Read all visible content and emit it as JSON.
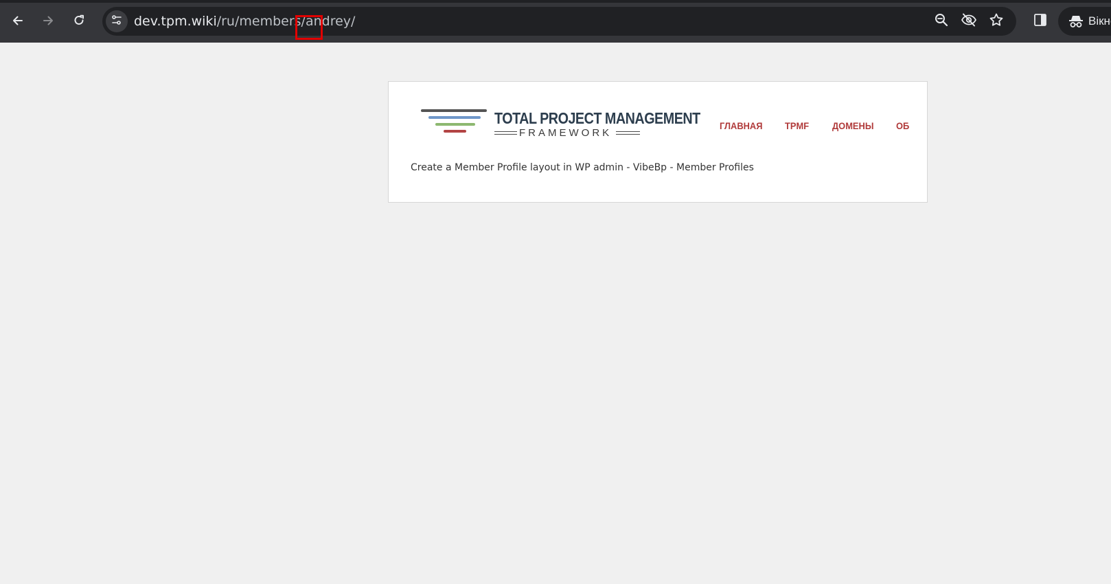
{
  "browser": {
    "url_host": "dev.tpm.wiki",
    "url_path": "/ru/members/andrey/",
    "incognito_label": "Вікно"
  },
  "site": {
    "logo_title": "TOTAL PROJECT MANAGEMENT",
    "logo_subtitle": "FRAMEWORK",
    "logo_colors": [
      "#555555",
      "#6f97c9",
      "#8db870",
      "#b34444"
    ],
    "menu": [
      {
        "label": "ГЛАВНАЯ"
      },
      {
        "label": "TPMF"
      },
      {
        "label": "ДОМЕНЫ"
      },
      {
        "label": "ОБ"
      }
    ],
    "content_text": "Create a Member Profile layout in WP admin - VibeBp - Member Profiles"
  },
  "annotation": {
    "highlight_color": "#e10000"
  }
}
